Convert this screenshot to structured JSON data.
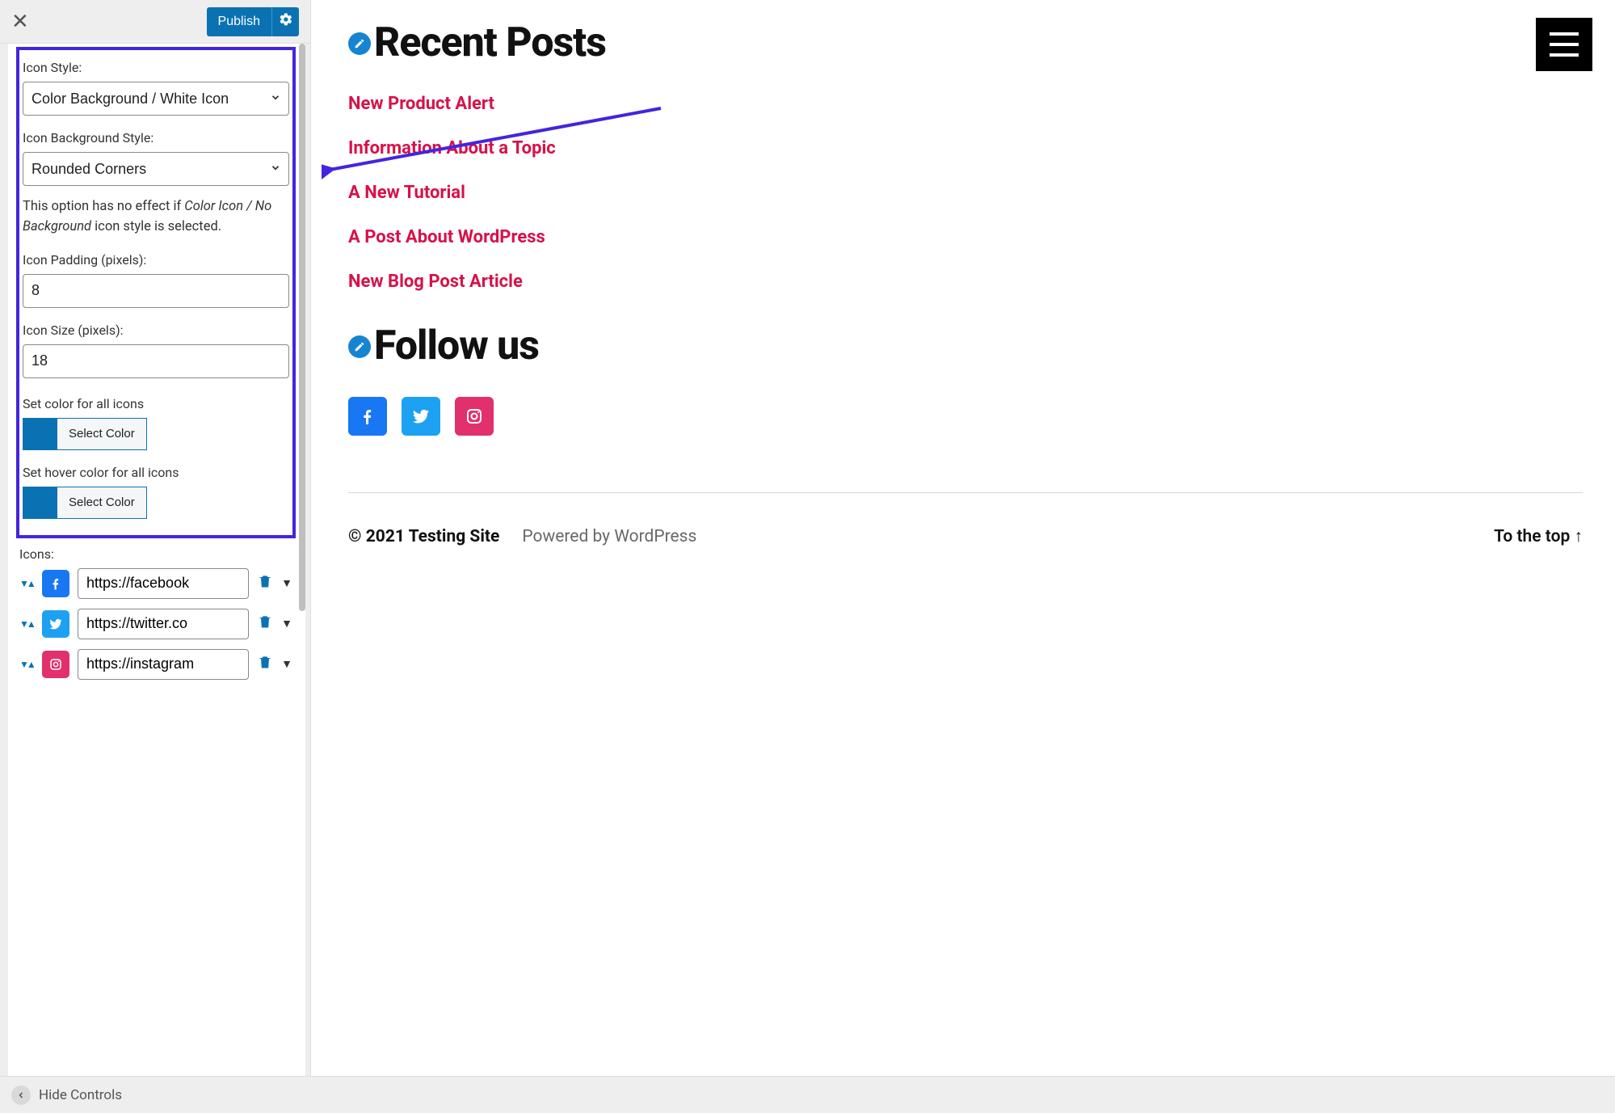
{
  "top": {
    "publish_label": "Publish"
  },
  "panel": {
    "icon_style_label": "Icon Style:",
    "icon_style_value": "Color Background / White Icon",
    "bg_style_label": "Icon Background Style:",
    "bg_style_value": "Rounded Corners",
    "help_pre": "This option has no effect if ",
    "help_em": "Color Icon / No Background",
    "help_post": " icon style is selected.",
    "padding_label": "Icon Padding (pixels):",
    "padding_value": "8",
    "size_label": "Icon Size (pixels):",
    "size_value": "18",
    "set_color_label": "Set color for all icons",
    "set_hover_label": "Set hover color for all icons",
    "select_color_btn": "Select Color",
    "icons_label": "Icons:",
    "rows": [
      {
        "network": "facebook",
        "url": "https://facebook"
      },
      {
        "network": "twitter",
        "url": "https://twitter.co"
      },
      {
        "network": "instagram",
        "url": "https://instagram"
      }
    ],
    "swatch_color": "#0a72b3"
  },
  "bottom": {
    "hide_label": "Hide Controls"
  },
  "preview": {
    "recent_title": "Recent Posts",
    "posts": [
      "New Product Alert",
      "Information About a Topic",
      "A New Tutorial",
      "A Post About WordPress",
      "New Blog Post Article"
    ],
    "follow_title": "Follow us",
    "copyright": "© 2021 Testing Site",
    "powered": "Powered by WordPress",
    "to_top": "To the top ↑"
  }
}
